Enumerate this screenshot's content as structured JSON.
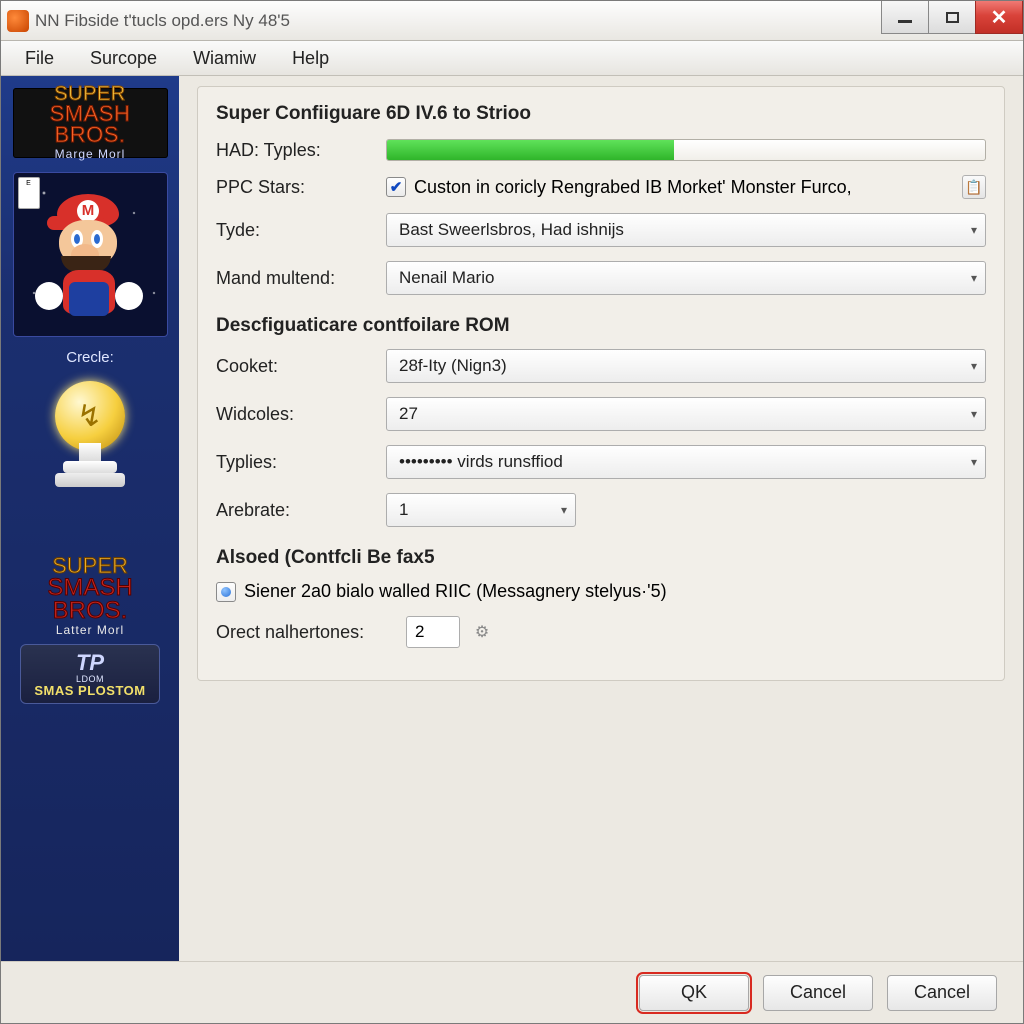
{
  "title": "NN Fibside t'tucls opd.ers Ny 48'5",
  "menu": {
    "file": "File",
    "surcope": "Surcope",
    "wiamiw": "Wiamiw",
    "help": "Help"
  },
  "sidebar": {
    "logo1": {
      "l1": "SUPER",
      "l2": "SMASH BROS.",
      "l3": "Marge Morl"
    },
    "rating": "E",
    "crecle": "Crecle:",
    "logo2": {
      "l1": "SUPER",
      "l2": "SMASH BROS.",
      "l3": "Latter Morl"
    },
    "badge": {
      "l1": "TP",
      "l2": "LDOM",
      "l3": "SMAS PLOSTOM"
    }
  },
  "section1": {
    "title": "Super Confiiguare 6D IV.6 to Strioo",
    "had_label": "HAD: Typles:",
    "progress_pct": 48,
    "ppc_label": "PPC Stars:",
    "ppc_checked": true,
    "ppc_text": "Custon in coricly Rengrabed IB Morket' Monster Furco,",
    "tyde_label": "Tyde:",
    "tyde_value": "Bast Sweerlsbros, Had ishnijs",
    "mand_label": "Mand multend:",
    "mand_value": "Nenail Mario"
  },
  "section2": {
    "title": "Descfiguaticare contfoilare ROM",
    "cooket_label": "Cooket:",
    "cooket_value": "28f-Ity (Nign3)",
    "widcoles_label": "Widcoles:",
    "widcoles_value": "27",
    "typlies_label": "Typlies:",
    "typlies_value": "••••••••• virds runsffiod",
    "arebrate_label": "Arebrate:",
    "arebrate_value": "1"
  },
  "section3": {
    "title": "Alsoed (Contfcli Be fax5",
    "radio_label": "Siener 2a0 bialo walled RIIC (Messagnery stelyus·'5)",
    "orect_label": "Orect nalhertones:",
    "orect_value": "2"
  },
  "buttons": {
    "ok": "QK",
    "cancel1": "Cаncel",
    "cancel2": "Cаncel"
  }
}
